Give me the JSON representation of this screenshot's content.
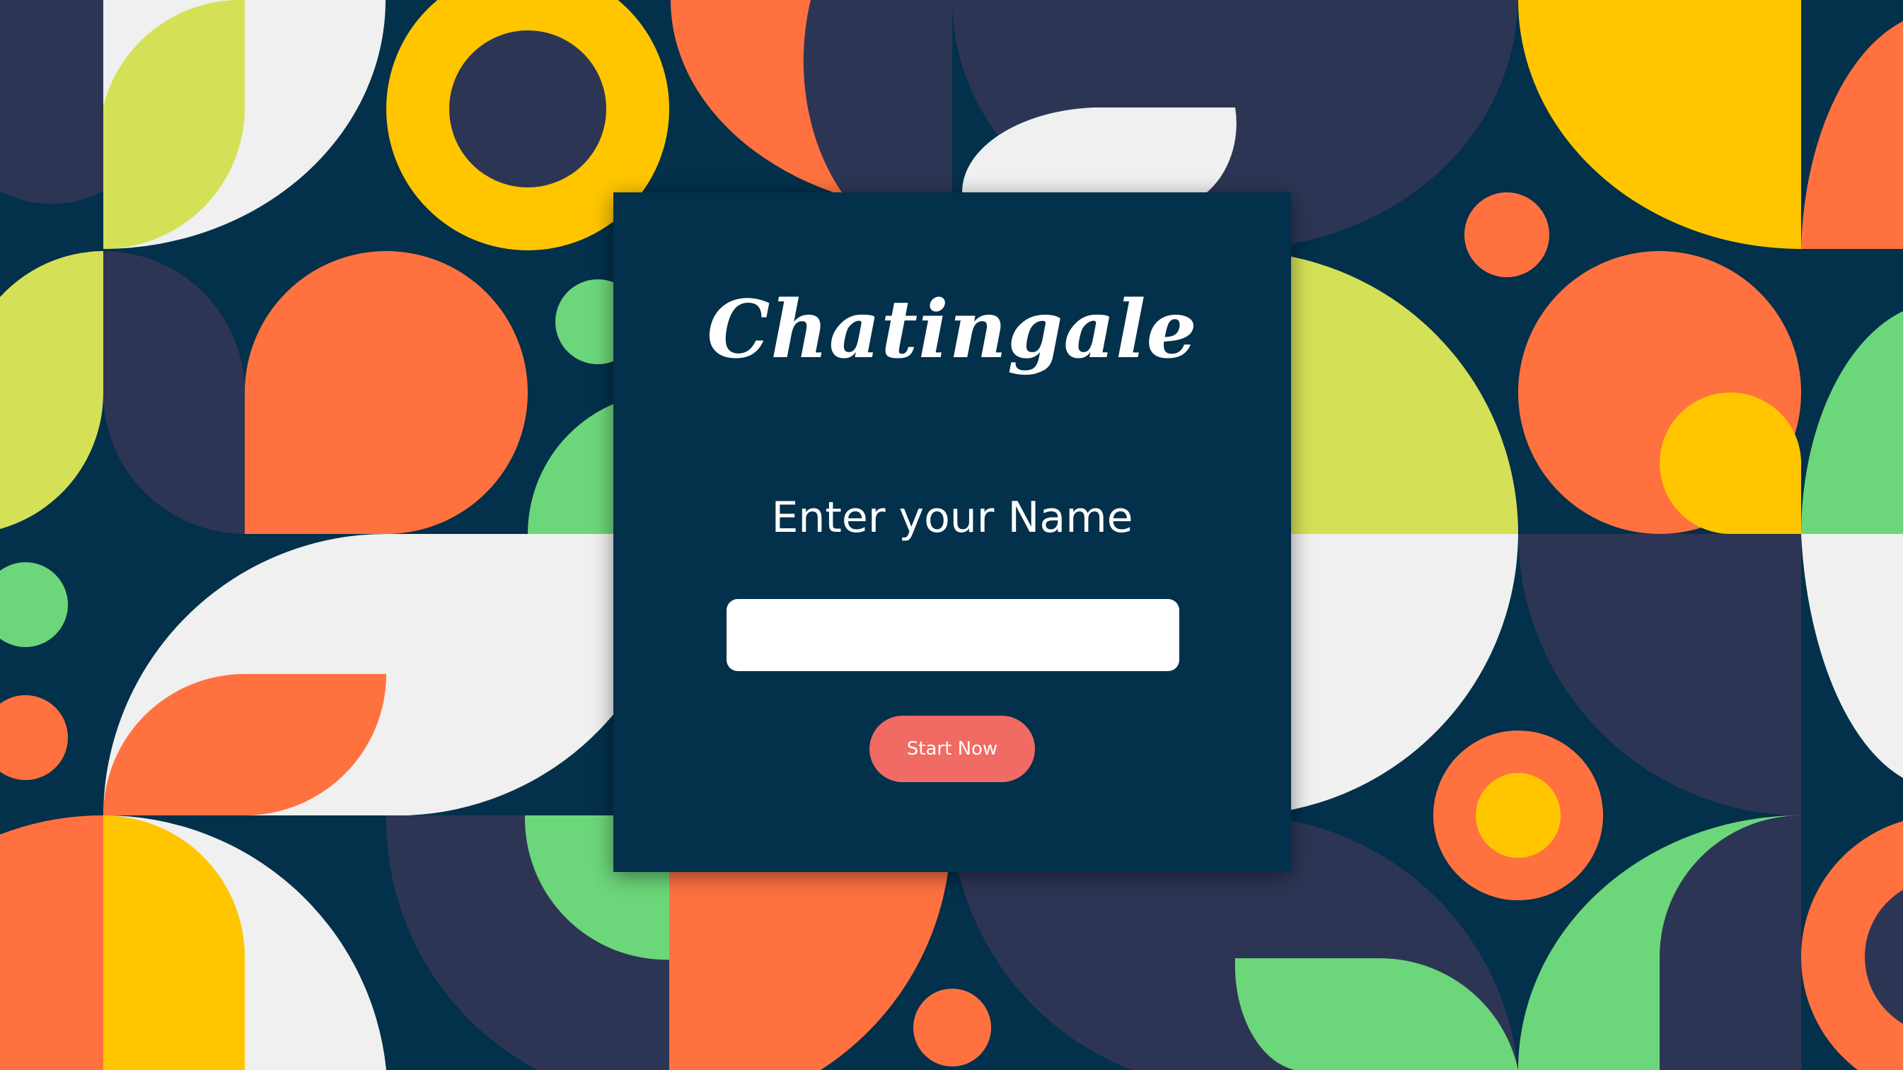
{
  "app": {
    "logo_text": "Chatingale"
  },
  "form": {
    "prompt_label": "Enter your Name",
    "name_value": "",
    "name_placeholder": "",
    "start_label": "Start Now"
  },
  "colors": {
    "background": "#03304a",
    "card": "#03304a",
    "button": "#f06b64",
    "orange": "#ff7240",
    "yellow": "#ffc600",
    "lime": "#d4e157",
    "green": "#6cd67a",
    "navy": "#2d3555",
    "white": "#eff0ef"
  }
}
